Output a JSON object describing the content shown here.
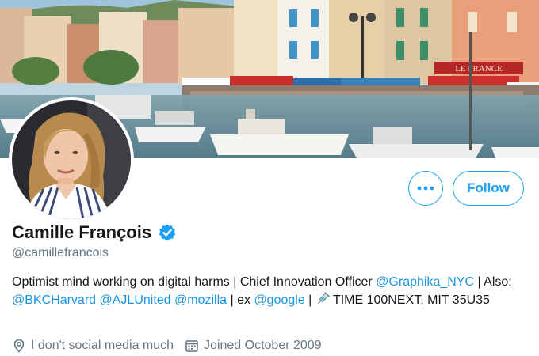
{
  "profile": {
    "display_name": "Camille François",
    "handle": "@camillefrancois",
    "bio": {
      "t1": "Optimist mind working on digital harms | Chief Innovation Officer ",
      "m1": "@Graphika_NYC",
      "t2": " | Also: ",
      "m2": "@BKCHarvard",
      "t3": " ",
      "m3": "@AJLUnited",
      "t4": " ",
      "m4": "@mozilla",
      "t5": " | ex ",
      "m5": "@google",
      "t6": " | ",
      "t7": " TIME 100NEXT, MIT 35U35"
    },
    "location": "I don't social media much",
    "joined": "Joined October 2009"
  },
  "actions": {
    "follow_label": "Follow"
  },
  "banner": {
    "shop_sign": "LE FRANCE"
  },
  "colors": {
    "accent": "#1da1f2",
    "mention": "#1b95e0",
    "secondary_text": "#657786"
  },
  "icons": {
    "more": "more-dots-icon",
    "verified": "verified-badge-icon",
    "location": "location-pin-icon",
    "calendar": "calendar-icon",
    "syringe": "syringe-emoji-icon"
  }
}
